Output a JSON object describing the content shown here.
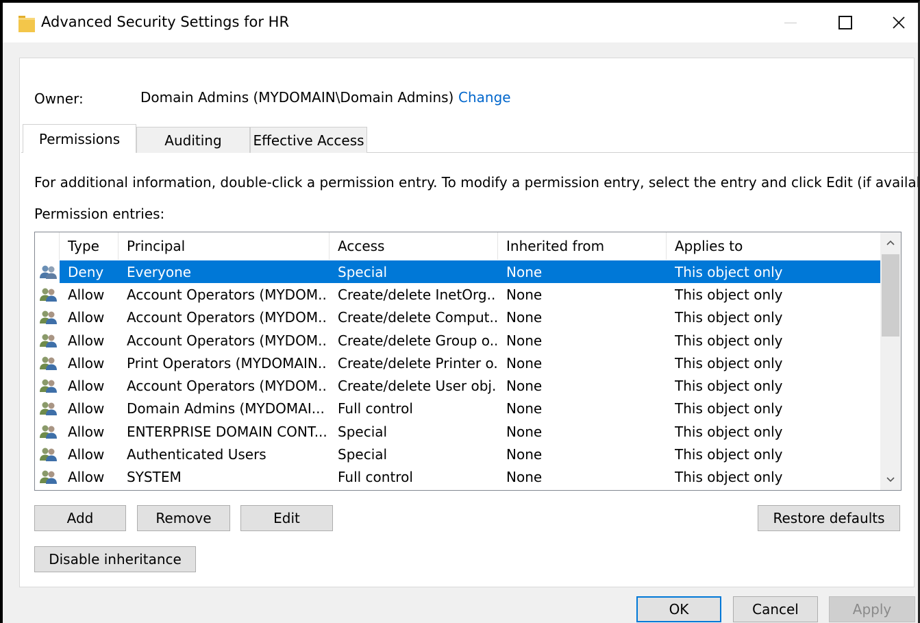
{
  "window": {
    "title": "Advanced Security Settings for HR",
    "controls": {
      "minimize": "—",
      "maximize": "□",
      "close": "✕"
    }
  },
  "owner": {
    "label": "Owner:",
    "value": "Domain Admins (MYDOMAIN\\Domain Admins)",
    "change_link": "Change"
  },
  "tabs": [
    {
      "label": "Permissions",
      "active": true
    },
    {
      "label": "Auditing",
      "active": false
    },
    {
      "label": "Effective Access",
      "active": false
    }
  ],
  "info_text": "For additional information, double-click a permission entry. To modify a permission entry, select the entry and click Edit (if available).",
  "entries_label": "Permission entries:",
  "columns": [
    "Type",
    "Principal",
    "Access",
    "Inherited from",
    "Applies to"
  ],
  "entries": [
    {
      "type": "Deny",
      "principal": "Everyone",
      "access": "Special",
      "inherited": "None",
      "applies": "This object only",
      "selected": true
    },
    {
      "type": "Allow",
      "principal": "Account Operators (MYDOM...",
      "access": "Create/delete InetOrg...",
      "inherited": "None",
      "applies": "This object only"
    },
    {
      "type": "Allow",
      "principal": "Account Operators (MYDOM...",
      "access": "Create/delete Comput...",
      "inherited": "None",
      "applies": "This object only"
    },
    {
      "type": "Allow",
      "principal": "Account Operators (MYDOM...",
      "access": "Create/delete Group o...",
      "inherited": "None",
      "applies": "This object only"
    },
    {
      "type": "Allow",
      "principal": "Print Operators (MYDOMAIN...",
      "access": "Create/delete Printer o...",
      "inherited": "None",
      "applies": "This object only"
    },
    {
      "type": "Allow",
      "principal": "Account Operators (MYDOM...",
      "access": "Create/delete User obj...",
      "inherited": "None",
      "applies": "This object only"
    },
    {
      "type": "Allow",
      "principal": "Domain Admins (MYDOMAI...",
      "access": "Full control",
      "inherited": "None",
      "applies": "This object only"
    },
    {
      "type": "Allow",
      "principal": "ENTERPRISE DOMAIN CONT...",
      "access": "Special",
      "inherited": "None",
      "applies": "This object only"
    },
    {
      "type": "Allow",
      "principal": "Authenticated Users",
      "access": "Special",
      "inherited": "None",
      "applies": "This object only"
    },
    {
      "type": "Allow",
      "principal": "SYSTEM",
      "access": "Full control",
      "inherited": "None",
      "applies": "This object only"
    }
  ],
  "buttons": {
    "add": "Add",
    "remove": "Remove",
    "edit": "Edit",
    "restore_defaults": "Restore defaults",
    "disable_inheritance": "Disable inheritance",
    "ok": "OK",
    "cancel": "Cancel",
    "apply": "Apply"
  },
  "icons": {
    "title": "folder-icon",
    "entry": "users-group-icon",
    "scroll_up": "chevron-up-icon",
    "scroll_down": "chevron-down-icon"
  },
  "colors": {
    "selection": "#0078d7",
    "link": "#0066cc",
    "folder": "#f3c64a"
  }
}
